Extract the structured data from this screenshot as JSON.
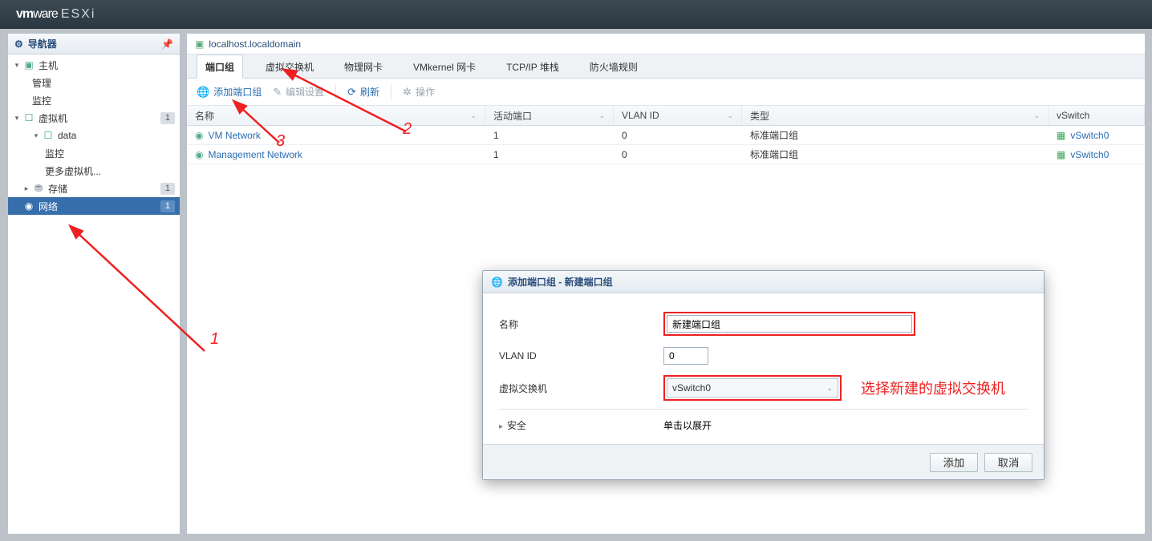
{
  "brand": {
    "vm": "vm",
    "ware": "ware",
    "prod": "ESXi"
  },
  "navigator": {
    "title": "导航器"
  },
  "sidebar": {
    "host": "主机",
    "manage": "管理",
    "monitor": "监控",
    "vms": "虚拟机",
    "data": "data",
    "morevms": "更多虚拟机...",
    "storage": "存储",
    "network": "网络"
  },
  "badge": {
    "vms": "1",
    "storage": "1",
    "network": "1"
  },
  "header": {
    "host": "localhost.localdomain"
  },
  "tabs": {
    "portgroups": "端口组",
    "vswitches": "虚拟交换机",
    "pnics": "物理网卡",
    "vmk": "VMkernel 网卡",
    "tcpip": "TCP/IP 堆栈",
    "firewall": "防火墙规则"
  },
  "toolbar": {
    "add": "添加端口组",
    "edit": "编辑设置",
    "refresh": "刷新",
    "actions": "操作"
  },
  "columns": {
    "name": "名称",
    "active": "活动端口",
    "vlan": "VLAN ID",
    "type": "类型",
    "vswitch": "vSwitch"
  },
  "rows": [
    {
      "name": "VM Network",
      "active": "1",
      "vlan": "0",
      "type": "标准端口组",
      "vswitch": "vSwitch0"
    },
    {
      "name": "Management Network",
      "active": "1",
      "vlan": "0",
      "type": "标准端口组",
      "vswitch": "vSwitch0"
    }
  ],
  "dialog": {
    "title": "添加端口组 - 新建端口组",
    "labels": {
      "name": "名称",
      "vlan": "VLAN ID",
      "vswitch": "虚拟交换机",
      "security": "安全"
    },
    "values": {
      "name": "新建端口组",
      "vlan": "0",
      "vswitch": "vSwitch0",
      "security": "单击以展开"
    },
    "buttons": {
      "add": "添加",
      "cancel": "取消"
    }
  },
  "annotations": {
    "num1": "1",
    "num2": "2",
    "num3": "3",
    "select_hint": "选择新建的虚拟交换机"
  }
}
